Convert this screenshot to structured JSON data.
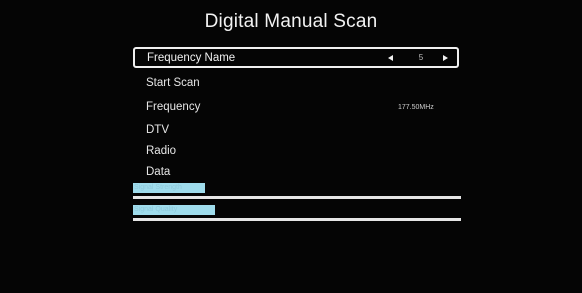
{
  "title": "Digital Manual Scan",
  "menu": {
    "frequency_name": {
      "label": "Frequency Name",
      "value": "5"
    },
    "start_scan": {
      "label": "Start Scan"
    },
    "frequency": {
      "label": "Frequency",
      "value": "177.50MHz"
    },
    "dtv": {
      "label": "DTV"
    },
    "radio": {
      "label": "Radio"
    },
    "data": {
      "label": "Data"
    }
  },
  "indicators": {
    "signal_strength": {
      "label": "Signal Strength"
    },
    "signal_quality": {
      "label": "Signal Quality"
    }
  },
  "colors": {
    "background": "#000000",
    "text": "#e6e6e6",
    "highlight": "#9fdcec"
  }
}
